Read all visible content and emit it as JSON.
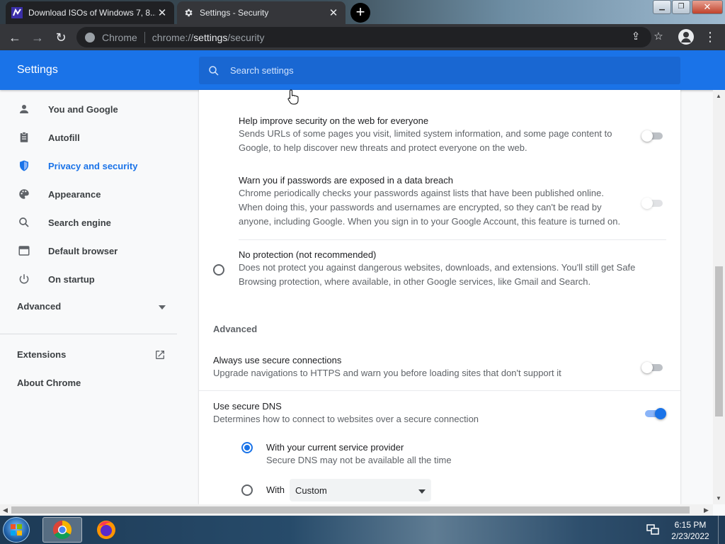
{
  "tabs": [
    {
      "title": "Download ISOs of Windows 7, 8...",
      "close": "✕"
    },
    {
      "title": "Settings - Security",
      "close": "✕"
    }
  ],
  "new_tab_label": "+",
  "window_controls": {
    "minimize": "▁",
    "maximize": "❐",
    "close": "✕"
  },
  "toolbar": {
    "back": "←",
    "forward": "→",
    "reload": "↻",
    "site_name": "Chrome",
    "url_scheme": "chrome://",
    "url_host": "settings",
    "url_path": "/security",
    "share": "⇪",
    "bookmark": "☆",
    "menu": "⋮"
  },
  "header": {
    "title": "Settings",
    "search_placeholder": "Search settings"
  },
  "sidebar": {
    "items": [
      {
        "label": "You and Google",
        "icon": "person-icon"
      },
      {
        "label": "Autofill",
        "icon": "clipboard-icon"
      },
      {
        "label": "Privacy and security",
        "icon": "shield-icon",
        "active": true
      },
      {
        "label": "Appearance",
        "icon": "palette-icon"
      },
      {
        "label": "Search engine",
        "icon": "search-icon"
      },
      {
        "label": "Default browser",
        "icon": "browser-window-icon"
      },
      {
        "label": "On startup",
        "icon": "power-icon"
      }
    ],
    "advanced": "Advanced",
    "extensions": "Extensions",
    "about": "About Chrome"
  },
  "main": {
    "help_improve": {
      "title": "Help improve security on the web for everyone",
      "line1": "Sends URLs of some pages you visit, limited system information, and some page content to",
      "line2": "Google, to help discover new threats and protect everyone on the web.",
      "enabled": false
    },
    "password_breach": {
      "title": "Warn you if passwords are exposed in a data breach",
      "line1": "Chrome periodically checks your passwords against lists that have been published online.",
      "line2": "When doing this, your passwords and usernames are encrypted, so they can't be read by",
      "line3": "anyone, including Google. When you sign in to your Google Account, this feature is turned on.",
      "enabled": false
    },
    "no_protection": {
      "title": "No protection (not recommended)",
      "line1": "Does not protect you against dangerous websites, downloads, and extensions. You'll still get Safe",
      "line2": "Browsing protection, where available, in other Google services, like Gmail and Search.",
      "selected": false
    },
    "advanced_label": "Advanced",
    "secure_connections": {
      "title": "Always use secure connections",
      "sub": "Upgrade navigations to HTTPS and warn you before loading sites that don't support it",
      "enabled": false
    },
    "secure_dns": {
      "title": "Use secure DNS",
      "sub": "Determines how to connect to websites over a secure connection",
      "enabled": true,
      "option_current": {
        "title": "With your current service provider",
        "sub": "Secure DNS may not be available all the time",
        "selected": true
      },
      "option_custom": {
        "label": "With",
        "select_value": "Custom",
        "selected": false
      }
    }
  },
  "taskbar": {
    "clock_time": "6:15 PM",
    "clock_date": "2/23/2022"
  },
  "colors": {
    "accent": "#1a73e8",
    "chrome_dark": "#35363a"
  }
}
